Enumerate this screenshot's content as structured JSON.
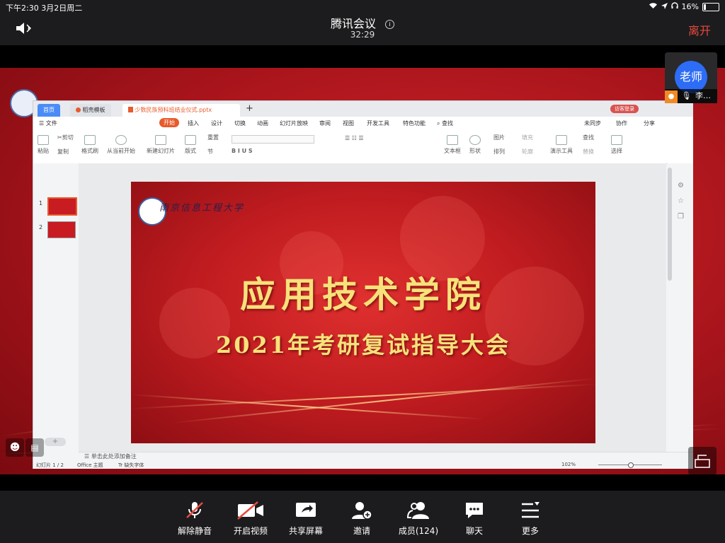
{
  "status_bar": {
    "time_date": "下午2:30   3月2日周二",
    "battery": "16%",
    "battery_level": 0.16
  },
  "meeting": {
    "title": "腾讯会议",
    "timer": "32:29",
    "leave_label": "离开"
  },
  "participant": {
    "avatar_text": "老师",
    "name": "李…"
  },
  "wps": {
    "tabs": [
      "首页",
      "稻壳模板",
      "少数民族预科班结业仪式.pptx"
    ],
    "login_label": "访客登录",
    "file_menu": "文件",
    "ribbon_tabs": [
      "开始",
      "插入",
      "设计",
      "切换",
      "动画",
      "幻灯片放映",
      "审阅",
      "视图",
      "开发工具",
      "特色功能",
      "查找"
    ],
    "right_actions": [
      "未同步",
      "协作",
      "分享"
    ],
    "ribbon_buttons": {
      "paste": "粘贴",
      "cut": "剪切",
      "copy": "复制",
      "format_painter": "格式刷",
      "from_current": "从当前开始",
      "new_slide": "新建幻灯片",
      "layout": "版式",
      "section": "节",
      "reset": "重置",
      "textbox": "文本框",
      "shape": "形状",
      "image": "图片",
      "fill": "填充",
      "arrange": "排列",
      "outline": "轮廓",
      "present_tools": "演示工具",
      "find": "查找",
      "replace": "替换",
      "select": "选择"
    },
    "notes_placeholder": "单击此处添加备注",
    "status": {
      "slide_count": "幻灯片 1 / 2",
      "theme": "Office 主题",
      "missing_font": "缺失字体",
      "zoom": "102%"
    }
  },
  "slide": {
    "university": "南京信息工程大学",
    "title": "应用技术学院",
    "subtitle": "2021年考研复试指导大会"
  },
  "toolbar": {
    "items": [
      {
        "label": "解除静音",
        "icon": "muted-mic-icon"
      },
      {
        "label": "开启视频",
        "icon": "video-off-icon"
      },
      {
        "label": "共享屏幕",
        "icon": "share-screen-icon"
      },
      {
        "label": "邀请",
        "icon": "invite-user-icon"
      },
      {
        "label": "成员(124)",
        "icon": "members-icon"
      },
      {
        "label": "聊天",
        "icon": "chat-icon"
      },
      {
        "label": "更多",
        "icon": "more-menu-icon"
      }
    ]
  },
  "colors": {
    "leave": "#e8493d",
    "slide_text": "#f6e27a",
    "avatar": "#2d6cf6",
    "wps_accent": "#e85a2b"
  }
}
